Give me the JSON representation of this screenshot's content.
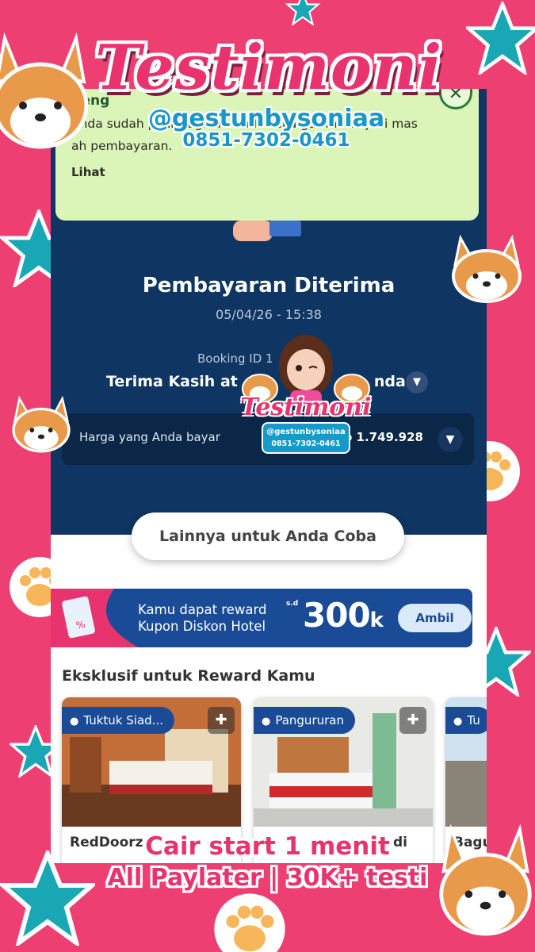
{
  "overlay": {
    "title": "Testimoni",
    "handle": "@gestunbysoniaa",
    "phone": "0851-7302-0461",
    "badge_title": "Testimoni",
    "badge_handle": "@gestunbysoniaa",
    "badge_phone": "0851-7302-0461",
    "footer_line1": "Cair start 1 menit",
    "footer_line2": "All Paylater | 30K+ testi"
  },
  "notice": {
    "title": "Peng",
    "body": "Anda sudah p                                          ian tagihan Anda seka         gar tak terjadi mas    ah pembayaran.",
    "link": "Lihat",
    "close": "✕"
  },
  "payment": {
    "title": "Pembayaran Diterima",
    "datetime": "05/04/26 - 15:38",
    "booking_id": "Booking ID 1",
    "thanks": "Terima Kasih at",
    "thanks_tail": "nda",
    "price_label": "Harga yang Anda bayar",
    "price_value": "Rp 1.749.928"
  },
  "more_button": "Lainnya untuk Anda Coba",
  "reward": {
    "line1": "Kamu dapat reward",
    "line2": "Kupon Diskon Hotel",
    "sd": "s.d",
    "amount": "300",
    "amount_unit": "k",
    "button": "Ambil"
  },
  "section_title": "Eksklusif untuk Reward Kamu",
  "cards": [
    {
      "location": "Tuktuk Siad...",
      "title": "RedDoorz"
    },
    {
      "location": "Pangururan",
      "title": "di"
    },
    {
      "location": "Tu",
      "title": "Bagu"
    }
  ],
  "icons": {
    "chevron": "chevron-down-icon",
    "bookmark": "bookmark-icon",
    "pin": "location-pin-icon"
  },
  "colors": {
    "background": "#ee3f73",
    "hero": "#0f3562",
    "notice": "#dbf5b8",
    "reward": "#1a4b96",
    "star": "#19a7b6",
    "paw": "#f7b65a"
  }
}
